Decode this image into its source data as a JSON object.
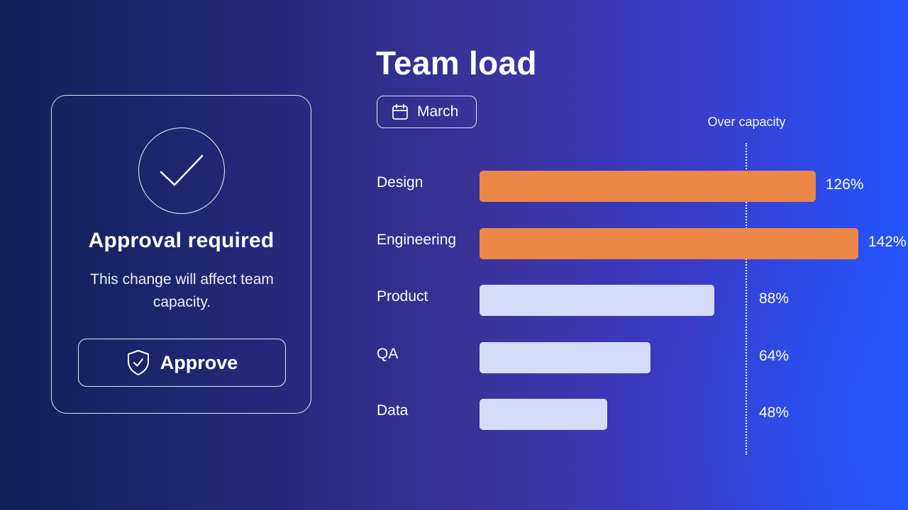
{
  "approval": {
    "title": "Approval required",
    "description": "This change will affect team capacity.",
    "approve_label": "Approve"
  },
  "panel": {
    "title": "Team load",
    "month_label": "March",
    "threshold_label": "Over capacity"
  },
  "colors": {
    "over_capacity": "#ec8748",
    "under_capacity": "#d3ddfa"
  },
  "icons": {
    "card": "check-circle-icon",
    "approve": "shield-check-icon",
    "month": "calendar-icon"
  },
  "chart_data": {
    "type": "bar",
    "orientation": "horizontal",
    "categories": [
      "Design",
      "Engineering",
      "Product",
      "QA",
      "Data"
    ],
    "values": [
      126,
      142,
      88,
      64,
      48
    ],
    "value_labels": [
      "126%",
      "142%",
      "88%",
      "64%",
      "48%"
    ],
    "unit": "%",
    "threshold": 100,
    "xlim": [
      0,
      142
    ]
  }
}
